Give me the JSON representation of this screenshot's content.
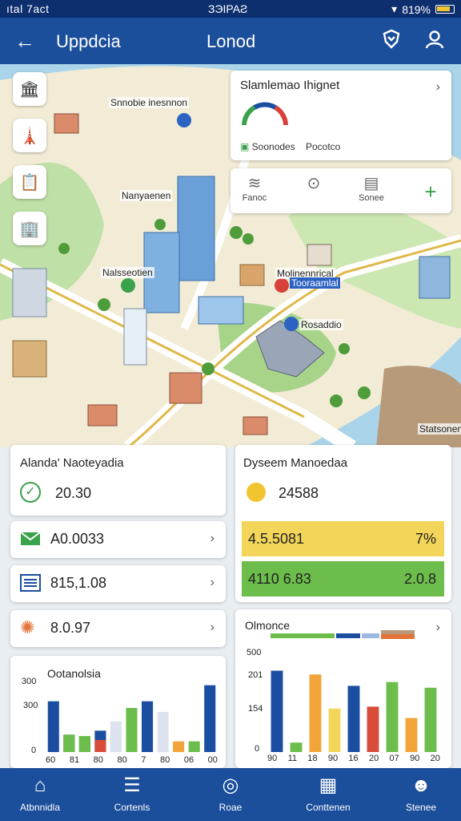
{
  "status_bar": {
    "left": "ıtal 7act",
    "center": "ЗЭΙPAƧ",
    "right": "819%"
  },
  "app_bar": {
    "title": "Uppdcia",
    "center_title": "Lonod",
    "back_icon": "arrow-left-icon",
    "action_icon": "heart-shield-icon",
    "profile_icon": "user-icon"
  },
  "map": {
    "labels": [
      "Snnobie inesnnon",
      "Nanyaenen",
      "Nalsseotien",
      "Molinennrical",
      "Tooraamlal",
      "Rosaddio",
      "Statsonen"
    ],
    "tools": [
      "museum-icon",
      "tower-icon",
      "document-icon",
      "building-icon"
    ]
  },
  "info_card": {
    "title": "Slamlemao Ihignet",
    "sub1": "Soonodes",
    "sub2": "Pocotco"
  },
  "action_card": {
    "actions": [
      {
        "label": "Fanoc",
        "icon": "wifi-icon"
      },
      {
        "label": "",
        "icon": "pin-icon"
      },
      {
        "label": "Sonee",
        "icon": "box-icon"
      },
      {
        "label": "",
        "icon": "plus-icon"
      }
    ]
  },
  "left_panel": {
    "title": "Alanda' Naoteyadia",
    "value": "20.30",
    "rows": [
      {
        "value": "A0.0033",
        "icon": "mail-icon"
      },
      {
        "value": "815,1.08",
        "icon": "list-icon"
      },
      {
        "value": "8.0.97",
        "icon": "maple-leaf-icon"
      }
    ]
  },
  "right_panel": {
    "title": "Dyseem Manoedaa",
    "value": "24588",
    "bands": [
      {
        "left": "4.5.5081",
        "right": "7%",
        "color": "#f3d55a"
      },
      {
        "left": "4110 6.83",
        "right": "2.0.8",
        "color": "#6cbd4b"
      }
    ]
  },
  "chart_left": {
    "title": "Ootanolsia",
    "yticks": [
      "300",
      "300",
      "0"
    ],
    "xticks": [
      "60",
      "81",
      "80",
      "80",
      "7",
      "80",
      "06",
      "00"
    ]
  },
  "chart_right": {
    "title": "Olmonce",
    "yticks": [
      "500",
      "201",
      "154",
      "0"
    ],
    "xticks": [
      "90",
      "11",
      "18",
      "90",
      "16",
      "20",
      "07",
      "90",
      "20"
    ]
  },
  "chart_data": [
    {
      "type": "bar",
      "title": "Ootanolsia",
      "ylim": [
        0,
        300
      ],
      "series": [
        {
          "color": "#1b4ea0",
          "values": [
            190,
            65,
            60,
            80,
            70,
            0,
            190,
            5,
            0,
            0,
            250
          ]
        },
        {
          "color": "#6cbd4b",
          "values": [
            0,
            65,
            60,
            0,
            0,
            165,
            0,
            0,
            0,
            40,
            0
          ]
        },
        {
          "color": "#dde3ee",
          "values": [
            0,
            0,
            0,
            0,
            115,
            0,
            0,
            150,
            0,
            0,
            0
          ]
        },
        {
          "color": "#d84c3a",
          "values": [
            0,
            0,
            0,
            45,
            0,
            0,
            0,
            0,
            0,
            0,
            0
          ]
        },
        {
          "color": "#f2a43a",
          "values": [
            0,
            0,
            0,
            0,
            0,
            0,
            0,
            0,
            40,
            0,
            0
          ]
        }
      ]
    },
    {
      "type": "bar",
      "title": "Olmonce",
      "ylim": [
        0,
        500
      ],
      "values": [
        430,
        50,
        410,
        230,
        350,
        240,
        370,
        180,
        340
      ],
      "colors": [
        "#1b4ea0",
        "#6cbd4b",
        "#f2a43a",
        "#f3d55a",
        "#1b4ea0",
        "#d84c3a",
        "#6cbd4b",
        "#f2a43a",
        "#6cbd4b"
      ]
    }
  ],
  "bottom_nav": [
    {
      "label": "Atbnnidla",
      "icon": "home-icon"
    },
    {
      "label": "Cortenls",
      "icon": "list-icon"
    },
    {
      "label": "Roae",
      "icon": "circle-icon"
    },
    {
      "label": "Conttenen",
      "icon": "grid-icon"
    },
    {
      "label": "Stenee",
      "icon": "user-icon"
    }
  ]
}
